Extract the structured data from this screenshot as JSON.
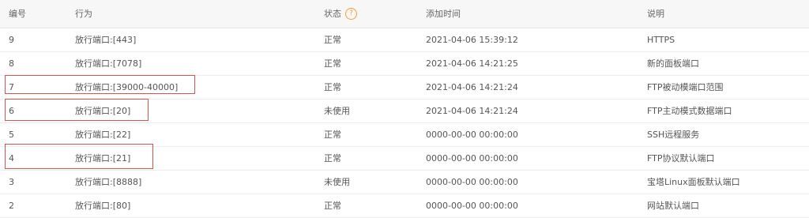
{
  "columns": {
    "id": "编号",
    "action": "行为",
    "status": "状态",
    "time": "添加时间",
    "desc": "说明"
  },
  "status_help_icon": "question-mark-circle-icon",
  "rows": [
    {
      "id": "9",
      "action": "放行端口:[443]",
      "status": "正常",
      "time": "2021-04-06 15:39:12",
      "desc": "HTTPS"
    },
    {
      "id": "8",
      "action": "放行端口:[7078]",
      "status": "正常",
      "time": "2021-04-06 14:21:25",
      "desc": "新的面板端口"
    },
    {
      "id": "7",
      "action": "放行端口:[39000-40000]",
      "status": "正常",
      "time": "2021-04-06 14:21:24",
      "desc": "FTP被动模端口范围"
    },
    {
      "id": "6",
      "action": "放行端口:[20]",
      "status": "未使用",
      "time": "2021-04-06 14:21:24",
      "desc": "FTP主动模式数据端口"
    },
    {
      "id": "5",
      "action": "放行端口:[22]",
      "status": "正常",
      "time": "0000-00-00 00:00:00",
      "desc": "SSH远程服务"
    },
    {
      "id": "4",
      "action": "放行端口:[21]",
      "status": "正常",
      "time": "0000-00-00 00:00:00",
      "desc": "FTP协议默认端口"
    },
    {
      "id": "3",
      "action": "放行端口:[8888]",
      "status": "未使用",
      "time": "0000-00-00 00:00:00",
      "desc": "宝塔Linux面板默认端口"
    },
    {
      "id": "2",
      "action": "放行端口:[80]",
      "status": "正常",
      "time": "0000-00-00 00:00:00",
      "desc": "网站默认端口"
    }
  ],
  "colors": {
    "highlight_border": "#d9534f",
    "help_icon": "#f0a030",
    "header_bg": "#f7f7f7"
  }
}
